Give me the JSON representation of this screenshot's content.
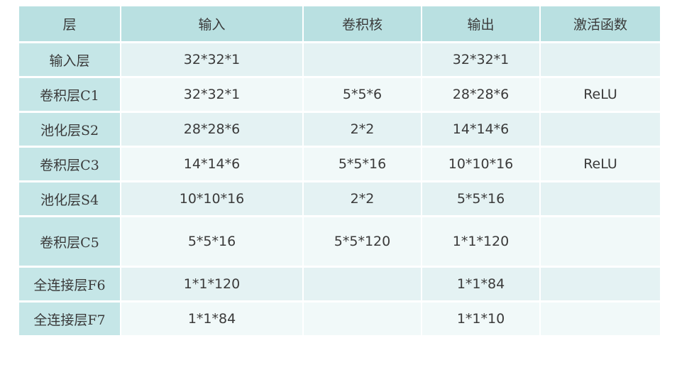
{
  "table": {
    "headers": [
      "层",
      "输入",
      "卷积核",
      "输出",
      "激活函数"
    ],
    "rows": [
      [
        "输入层",
        "32*32*1",
        "",
        "32*32*1",
        ""
      ],
      [
        "卷积层C1",
        "32*32*1",
        "5*5*6",
        "28*28*6",
        "ReLU"
      ],
      [
        "池化层S2",
        "28*28*6",
        "2*2",
        "14*14*6",
        ""
      ],
      [
        "卷积层C3",
        "14*14*6",
        "5*5*16",
        "10*10*16",
        "ReLU"
      ],
      [
        "池化层S4",
        "10*10*16",
        "2*2",
        "5*5*16",
        ""
      ],
      [
        "卷积层C5",
        "5*5*16",
        "5*5*120",
        "1*1*120",
        ""
      ],
      [
        "全连接层F6",
        "1*1*120",
        "",
        "1*1*84",
        ""
      ],
      [
        "全连接层F7",
        "1*1*84",
        "",
        "1*1*10",
        ""
      ]
    ]
  },
  "colors": {
    "header_bg": "#b9e0e1",
    "first_col_bg": "#c5e6e7",
    "row_odd": "#e4f2f3",
    "row_even": "#f1f9f9",
    "text": "#3a3a3a"
  }
}
